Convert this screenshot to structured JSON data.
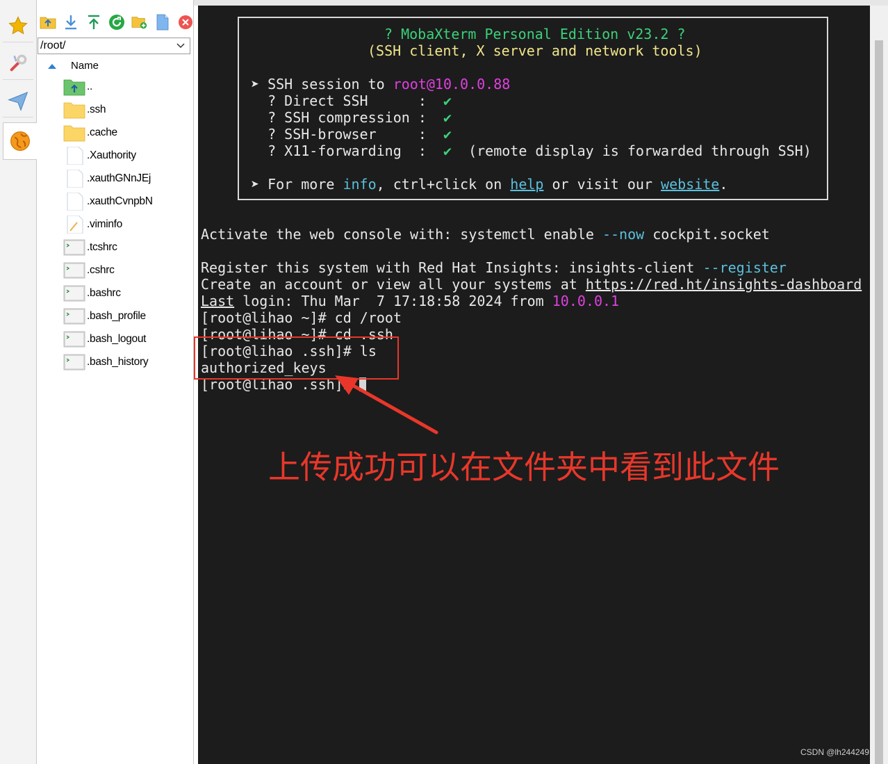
{
  "sidebar_tabs": [
    {
      "icon": "star-icon",
      "color": "#f2b500"
    },
    {
      "icon": "tools-icon",
      "color": "#e05050"
    },
    {
      "icon": "send-icon",
      "color": "#6aa4d8"
    },
    {
      "icon": "globe-icon",
      "color": "#f39a1e"
    }
  ],
  "sftp": {
    "path": "/root/",
    "column_name": "Name",
    "files": [
      {
        "name": "..",
        "type": "parent"
      },
      {
        "name": ".ssh",
        "type": "folder"
      },
      {
        "name": ".cache",
        "type": "folder"
      },
      {
        "name": ".Xauthority",
        "type": "file"
      },
      {
        "name": ".xauthGNnJEj",
        "type": "file"
      },
      {
        "name": ".xauthCvnpbN",
        "type": "file"
      },
      {
        "name": ".viminfo",
        "type": "text-file"
      },
      {
        "name": ".tcshrc",
        "type": "script"
      },
      {
        "name": ".cshrc",
        "type": "script"
      },
      {
        "name": ".bashrc",
        "type": "script"
      },
      {
        "name": ".bash_profile",
        "type": "script"
      },
      {
        "name": ".bash_logout",
        "type": "script"
      },
      {
        "name": ".bash_history",
        "type": "script"
      }
    ]
  },
  "terminal": {
    "banner": {
      "title": "? MobaXterm Personal Edition v23.2 ?",
      "subtitle": "(SSH client, X server and network tools)",
      "session_prefix": "➤ SSH session to ",
      "session_target": "root@10.0.0.88",
      "features": [
        {
          "label": "  ? Direct SSH      :  ",
          "check": "✔",
          "note": ""
        },
        {
          "label": "  ? SSH compression :  ",
          "check": "✔",
          "note": ""
        },
        {
          "label": "  ? SSH-browser     :  ",
          "check": "✔",
          "note": ""
        },
        {
          "label": "  ? X11-forwarding  :  ",
          "check": "✔",
          "note": "  (remote display is forwarded through SSH)"
        }
      ],
      "more_prefix": "➤ For more ",
      "more_info": "info",
      "more_mid": ", ctrl+click on ",
      "more_help": "help",
      "more_mid2": " or visit our ",
      "more_website": "website",
      "more_end": "."
    },
    "web_console_prefix": "Activate the web console with: systemctl enable ",
    "web_console_flag": "--now",
    "web_console_suffix": " cockpit.socket",
    "register_prefix": "Register this system with Red Hat Insights: insights-client ",
    "register_flag": "--register",
    "account_prefix": "Create an account or view all your systems at ",
    "account_url": "https://red.ht/insights-dashboard",
    "last_word": "Last",
    "last_mid": " login: Thu Mar  7 17:18:58 2024 from ",
    "last_ip": "10.0.0.1",
    "cmd1": "[root@lihao ~]# cd /root",
    "cmd2": "[root@lihao ~]# cd .ssh",
    "cmd3": "[root@lihao .ssh]# ls",
    "out1": "authorized_keys",
    "cmd4": "[root@lihao .ssh]# "
  },
  "annotation": {
    "caption": "上传成功可以在文件夹中看到此文件",
    "color": "#e8372a"
  },
  "watermark": "CSDN @lh244249"
}
